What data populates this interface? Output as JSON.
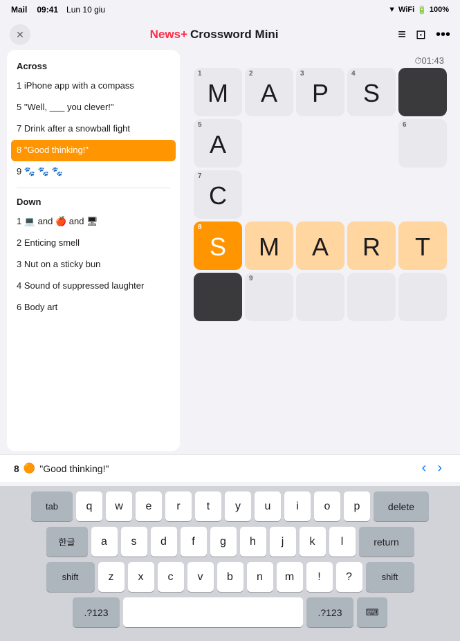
{
  "statusBar": {
    "carrier": "Mail",
    "time": "09:41",
    "date": "Lun 10 giu",
    "wifi": "wifi",
    "battery": "100%"
  },
  "navBar": {
    "backLabel": "Mail",
    "title": "Crossword Mini",
    "appLogo": "News+",
    "closeIcon": "✕"
  },
  "timer": "01:43",
  "clues": {
    "across": {
      "title": "Across",
      "items": [
        {
          "number": "1",
          "text": "iPhone app with a compass"
        },
        {
          "number": "5",
          "text": "\"Well, ___ you clever!\""
        },
        {
          "number": "7",
          "text": "Drink after a snowball fight"
        },
        {
          "number": "8",
          "text": "\"Good thinking!\"",
          "active": true
        },
        {
          "number": "9",
          "text": "🐾 🐾 🐾"
        }
      ]
    },
    "down": {
      "title": "Down",
      "items": [
        {
          "number": "1",
          "text": "💻 and 🍎 and 🖥"
        },
        {
          "number": "2",
          "text": "Enticing smell"
        },
        {
          "number": "3",
          "text": "Nut on a sticky bun"
        },
        {
          "number": "4",
          "text": "Sound of suppressed laughter"
        },
        {
          "number": "6",
          "text": "Body art"
        }
      ]
    }
  },
  "grid": {
    "rows": 5,
    "cols": 5,
    "cells": [
      {
        "row": 0,
        "col": 0,
        "letter": "M",
        "number": "1",
        "state": "normal"
      },
      {
        "row": 0,
        "col": 1,
        "letter": "A",
        "number": "2",
        "state": "normal"
      },
      {
        "row": 0,
        "col": 2,
        "letter": "P",
        "number": "3",
        "state": "normal"
      },
      {
        "row": 0,
        "col": 3,
        "letter": "S",
        "number": "4",
        "state": "normal"
      },
      {
        "row": 0,
        "col": 4,
        "letter": "",
        "number": "",
        "state": "black"
      },
      {
        "row": 1,
        "col": 0,
        "letter": "A",
        "number": "5",
        "state": "normal"
      },
      {
        "row": 1,
        "col": 1,
        "letter": "",
        "number": "",
        "state": "empty"
      },
      {
        "row": 1,
        "col": 2,
        "letter": "",
        "number": "",
        "state": "empty"
      },
      {
        "row": 1,
        "col": 3,
        "letter": "",
        "number": "",
        "state": "empty"
      },
      {
        "row": 1,
        "col": 4,
        "letter": "",
        "number": "6",
        "state": "normal"
      },
      {
        "row": 2,
        "col": 0,
        "letter": "C",
        "number": "7",
        "state": "normal"
      },
      {
        "row": 2,
        "col": 1,
        "letter": "",
        "number": "",
        "state": "empty"
      },
      {
        "row": 2,
        "col": 2,
        "letter": "",
        "number": "",
        "state": "empty"
      },
      {
        "row": 2,
        "col": 3,
        "letter": "",
        "number": "",
        "state": "empty"
      },
      {
        "row": 2,
        "col": 4,
        "letter": "",
        "number": "",
        "state": "empty"
      },
      {
        "row": 3,
        "col": 0,
        "letter": "S",
        "number": "8",
        "state": "active"
      },
      {
        "row": 3,
        "col": 1,
        "letter": "M",
        "number": "",
        "state": "highlighted"
      },
      {
        "row": 3,
        "col": 2,
        "letter": "A",
        "number": "",
        "state": "highlighted"
      },
      {
        "row": 3,
        "col": 3,
        "letter": "R",
        "number": "",
        "state": "highlighted"
      },
      {
        "row": 3,
        "col": 4,
        "letter": "T",
        "number": "",
        "state": "highlighted"
      },
      {
        "row": 4,
        "col": 0,
        "letter": "",
        "number": "",
        "state": "black"
      },
      {
        "row": 4,
        "col": 1,
        "letter": "",
        "number": "9",
        "state": "normal"
      },
      {
        "row": 4,
        "col": 2,
        "letter": "",
        "number": "",
        "state": "normal"
      },
      {
        "row": 4,
        "col": 3,
        "letter": "",
        "number": "",
        "state": "normal"
      },
      {
        "row": 4,
        "col": 4,
        "letter": "",
        "number": "",
        "state": "normal"
      }
    ]
  },
  "clueHint": {
    "number": "8",
    "emoji": "🟠",
    "text": "\"Good thinking!\""
  },
  "keyboard": {
    "rows": [
      [
        {
          "label": "tab",
          "type": "dark",
          "size": "wide"
        },
        {
          "label": "q",
          "type": "light",
          "sub": ""
        },
        {
          "label": "w",
          "type": "light",
          "sub": ""
        },
        {
          "label": "e",
          "type": "light",
          "sub": ""
        },
        {
          "label": "r",
          "type": "light",
          "sub": ""
        },
        {
          "label": "t",
          "type": "light",
          "sub": ""
        },
        {
          "label": "y",
          "type": "light",
          "sub": ""
        },
        {
          "label": "u",
          "type": "light",
          "sub": ""
        },
        {
          "label": "i",
          "type": "light",
          "sub": ""
        },
        {
          "label": "o",
          "type": "light",
          "sub": ""
        },
        {
          "label": "p",
          "type": "light",
          "sub": ""
        },
        {
          "label": "delete",
          "type": "dark",
          "size": "wide"
        }
      ],
      [
        {
          "label": "한글",
          "type": "dark",
          "size": "wide"
        },
        {
          "label": "a",
          "type": "light",
          "sub": ""
        },
        {
          "label": "s",
          "type": "light",
          "sub": ""
        },
        {
          "label": "d",
          "type": "light",
          "sub": ""
        },
        {
          "label": "f",
          "type": "light",
          "sub": ""
        },
        {
          "label": "g",
          "type": "light",
          "sub": ""
        },
        {
          "label": "h",
          "type": "light",
          "sub": ""
        },
        {
          "label": "j",
          "type": "light",
          "sub": ""
        },
        {
          "label": "k",
          "type": "light",
          "sub": ""
        },
        {
          "label": "l",
          "type": "light",
          "sub": ""
        },
        {
          "label": "return",
          "type": "dark",
          "size": "extra-wide"
        }
      ],
      [
        {
          "label": "shift",
          "type": "dark",
          "size": "shift"
        },
        {
          "label": "z",
          "type": "light",
          "sub": ""
        },
        {
          "label": "x",
          "type": "light",
          "sub": ""
        },
        {
          "label": "c",
          "type": "light",
          "sub": ""
        },
        {
          "label": "v",
          "type": "light",
          "sub": ""
        },
        {
          "label": "b",
          "type": "light",
          "sub": ""
        },
        {
          "label": "n",
          "type": "light",
          "sub": ""
        },
        {
          "label": "m",
          "type": "light",
          "sub": ""
        },
        {
          "label": "!",
          "type": "light",
          "sub": ""
        },
        {
          "label": "?",
          "type": "light",
          "sub": ""
        },
        {
          "label": "shift",
          "type": "dark",
          "size": "shift"
        }
      ],
      [
        {
          "label": ".?123",
          "type": "dark",
          "size": "numbers-key"
        },
        {
          "label": "",
          "type": "light",
          "size": "space-bar"
        },
        {
          "label": ".?123",
          "type": "dark",
          "size": "numbers-key"
        },
        {
          "label": "⌨",
          "type": "dark",
          "size": "kb-icon"
        }
      ]
    ]
  }
}
